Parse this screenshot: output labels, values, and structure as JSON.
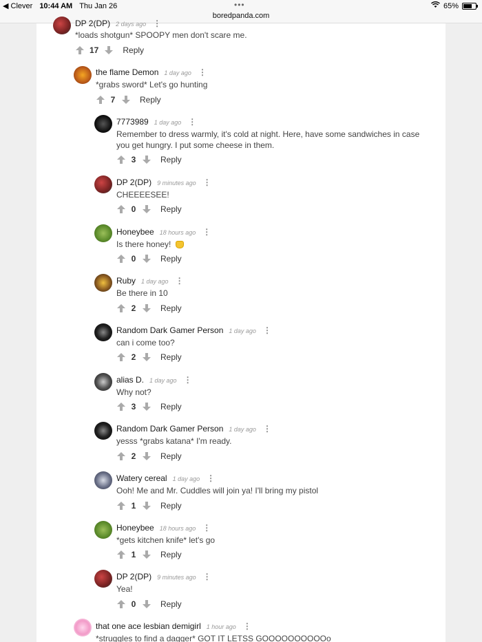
{
  "status": {
    "back_app": "◀ Clever",
    "time": "10:44 AM",
    "date": "Thu Jan 26",
    "battery": "65%"
  },
  "url": "boredpanda.com",
  "comments": [
    {
      "author": "DP 2(DP)",
      "time": "2 days ago",
      "text": "*loads shotgun* SPOOPY men don't scare me.",
      "votes": "17",
      "reply": "Reply"
    },
    {
      "author": "the flame Demon",
      "time": "1 day ago",
      "text": "*grabs sword* Let's go hunting",
      "votes": "7",
      "reply": "Reply"
    },
    {
      "author": "7773989",
      "time": "1 day ago",
      "text": "Remember to dress warmly, it's cold at night. Here, have some sandwiches in case you get hungry. I put some cheese in them.",
      "votes": "3",
      "reply": "Reply"
    },
    {
      "author": "DP 2(DP)",
      "time": "9 minutes ago",
      "text": "CHEEEESEE!",
      "votes": "0",
      "reply": "Reply"
    },
    {
      "author": "Honeybee",
      "time": "18 hours ago",
      "text": "Is there honey!",
      "votes": "0",
      "reply": "Reply"
    },
    {
      "author": "Ruby",
      "time": "1 day ago",
      "text": "Be there in 10",
      "votes": "2",
      "reply": "Reply"
    },
    {
      "author": "Random Dark Gamer Person",
      "time": "1 day ago",
      "text": "can i come too?",
      "votes": "2",
      "reply": "Reply"
    },
    {
      "author": "alias D.",
      "time": "1 day ago",
      "text": "Why not?",
      "votes": "3",
      "reply": "Reply"
    },
    {
      "author": "Random Dark Gamer Person",
      "time": "1 day ago",
      "text": "yesss *grabs katana* I'm ready.",
      "votes": "2",
      "reply": "Reply"
    },
    {
      "author": "Watery cereal",
      "time": "1 day ago",
      "text": "Ooh! Me and Mr. Cuddles will join ya! I'll bring my pistol",
      "votes": "1",
      "reply": "Reply"
    },
    {
      "author": "Honeybee",
      "time": "18 hours ago",
      "text": "*gets kitchen knife* let's go",
      "votes": "1",
      "reply": "Reply"
    },
    {
      "author": "DP 2(DP)",
      "time": "9 minutes ago",
      "text": "Yea!",
      "votes": "0",
      "reply": "Reply"
    },
    {
      "author": "that one ace lesbian demigirl",
      "time": "1 hour ago",
      "text": "*struggles to find a dagger* GOT IT LETSS GOOOOOOOOOOo",
      "votes": "",
      "reply": ""
    }
  ],
  "colors": {
    "background": "#efefef",
    "card": "#ffffff",
    "arrow": "#aaaaaa"
  }
}
